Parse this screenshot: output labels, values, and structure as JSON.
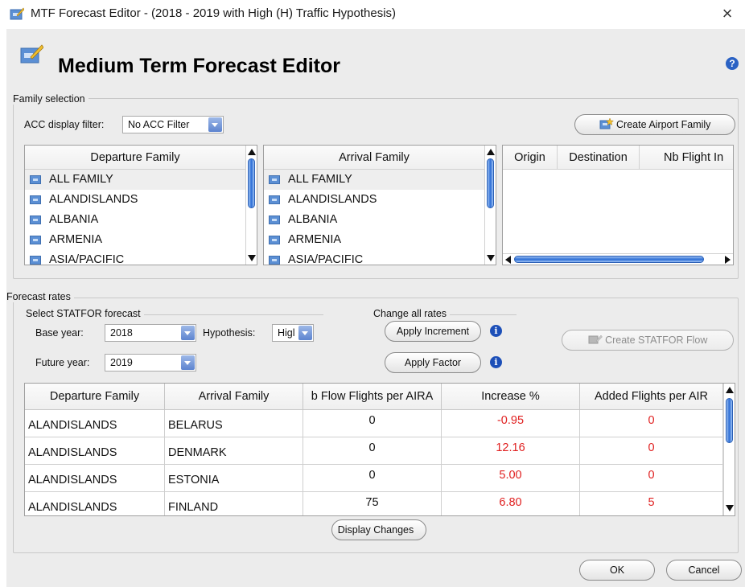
{
  "window": {
    "title": "MTF Forecast Editor - (2018 - 2019 with High (H) Traffic Hypothesis)",
    "close_glyph": "×"
  },
  "header": {
    "title": "Medium Term Forecast Editor",
    "help_glyph": "?"
  },
  "family_selection": {
    "label": "Family selection",
    "acc_filter_label": "ACC display filter:",
    "acc_filter_value": "No ACC Filter",
    "create_airport_family": "Create Airport Family",
    "departure": {
      "header": "Departure Family",
      "items": [
        "ALL FAMILY",
        "ALANDISLANDS",
        "ALBANIA",
        "ARMENIA",
        "ASIA/PACIFIC"
      ]
    },
    "arrival": {
      "header": "Arrival Family",
      "items": [
        "ALL FAMILY",
        "ALANDISLANDS",
        "ALBANIA",
        "ARMENIA",
        "ASIA/PACIFIC"
      ]
    },
    "flows": {
      "columns": [
        "Origin",
        "Destination",
        "Nb Flight In"
      ]
    }
  },
  "forecast_rates": {
    "label": "Forecast rates",
    "statfor_label": "Select STATFOR forecast",
    "base_year_label": "Base year:",
    "base_year_value": "2018",
    "hypothesis_label": "Hypothesis:",
    "hypothesis_value": "Higl",
    "future_year_label": "Future year:",
    "future_year_value": "2019",
    "change_all_label": "Change all rates",
    "apply_increment": "Apply Increment",
    "apply_factor": "Apply Factor",
    "info_glyph": "i",
    "create_statfor_flow": "Create STATFOR Flow",
    "table": {
      "columns": [
        "Departure Family",
        "Arrival Family",
        "b Flow Flights per AIRA",
        "Increase %",
        "Added Flights per AIR"
      ],
      "rows": [
        {
          "dep": "ALANDISLANDS",
          "arr": "BELARUS",
          "nb": "0",
          "inc": "-0.95",
          "add": "0"
        },
        {
          "dep": "ALANDISLANDS",
          "arr": "DENMARK",
          "nb": "0",
          "inc": "12.16",
          "add": "0"
        },
        {
          "dep": "ALANDISLANDS",
          "arr": "ESTONIA",
          "nb": "0",
          "inc": "5.00",
          "add": "0"
        },
        {
          "dep": "ALANDISLANDS",
          "arr": "FINLAND",
          "nb": "75",
          "inc": "6.80",
          "add": "5"
        }
      ]
    },
    "display_changes": "Display Changes"
  },
  "footer": {
    "ok": "OK",
    "cancel": "Cancel"
  },
  "colors": {
    "accent": "#2d6ed6",
    "highlight_values": "#e02020"
  }
}
